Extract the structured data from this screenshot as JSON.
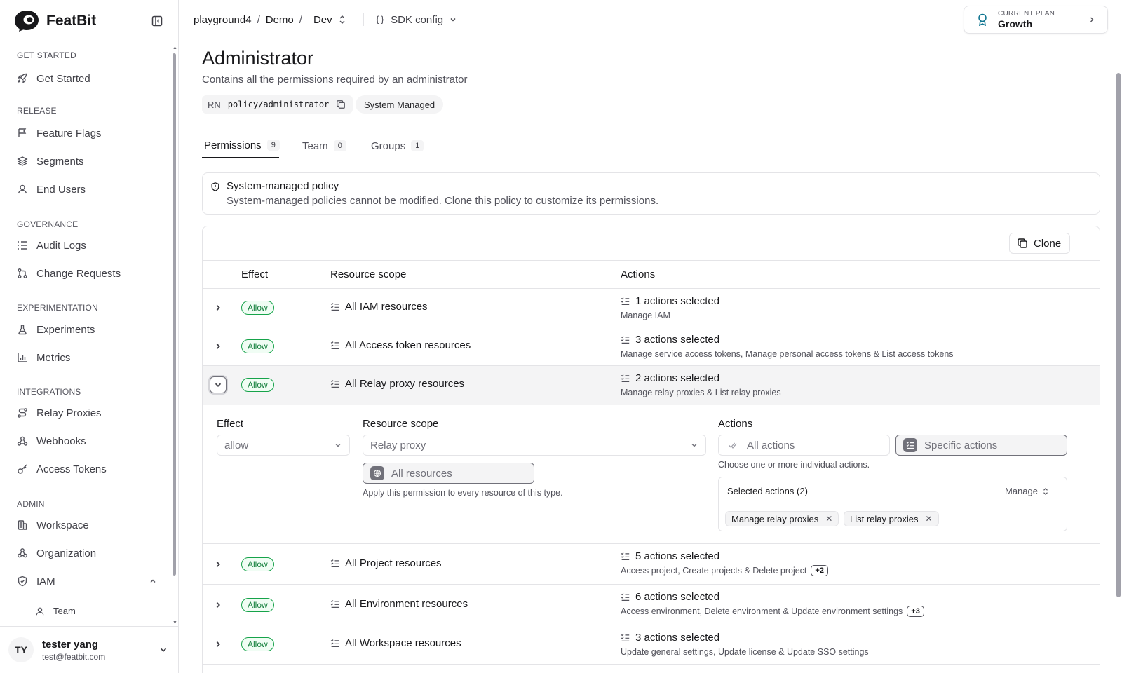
{
  "brand": {
    "name": "FeatBit"
  },
  "sidebar": {
    "sections": [
      {
        "label": "GET STARTED"
      },
      {
        "label": "RELEASE"
      },
      {
        "label": "GOVERNANCE"
      },
      {
        "label": "EXPERIMENTATION"
      },
      {
        "label": "INTEGRATIONS"
      },
      {
        "label": "ADMIN"
      }
    ],
    "items": [
      {
        "label": "Get Started",
        "icon": "rocket-icon"
      },
      {
        "label": "Feature Flags",
        "icon": "flag-icon"
      },
      {
        "label": "Segments",
        "icon": "layers-icon"
      },
      {
        "label": "End Users",
        "icon": "user-icon"
      },
      {
        "label": "Audit Logs",
        "icon": "list-icon"
      },
      {
        "label": "Change Requests",
        "icon": "git-pull-request-icon"
      },
      {
        "label": "Experiments",
        "icon": "flask-icon"
      },
      {
        "label": "Metrics",
        "icon": "bar-chart-icon"
      },
      {
        "label": "Relay Proxies",
        "icon": "route-icon"
      },
      {
        "label": "Webhooks",
        "icon": "webhook-icon"
      },
      {
        "label": "Access Tokens",
        "icon": "key-icon"
      },
      {
        "label": "Workspace",
        "icon": "building-icon"
      },
      {
        "label": "Organization",
        "icon": "network-icon"
      },
      {
        "label": "IAM",
        "icon": "shield-icon"
      }
    ],
    "subitems": [
      {
        "label": "Team",
        "icon": "user-icon"
      }
    ]
  },
  "user": {
    "initials": "TY",
    "name": "tester yang",
    "email": "test@featbit.com"
  },
  "breadcrumb": {
    "project": "playground4",
    "app": "Demo",
    "env": "Dev",
    "sdk": "SDK config"
  },
  "plan": {
    "label": "CURRENT PLAN",
    "value": "Growth"
  },
  "policy": {
    "title": "Administrator",
    "description": "Contains all the permissions required by an administrator",
    "rn_label": "RN",
    "rn_value": "policy/administrator",
    "system_badge": "System Managed"
  },
  "tabs": [
    {
      "label": "Permissions",
      "count": "9"
    },
    {
      "label": "Team",
      "count": "0"
    },
    {
      "label": "Groups",
      "count": "1"
    }
  ],
  "notice": {
    "title": "System-managed policy",
    "body": "System-managed policies cannot be modified. Clone this policy to customize its permissions."
  },
  "table": {
    "clone_label": "Clone",
    "headers": {
      "effect": "Effect",
      "scope": "Resource scope",
      "actions": "Actions"
    },
    "rows": [
      {
        "effect": "Allow",
        "scope": "All IAM resources",
        "actions_title": "1 actions selected",
        "actions_sub": "Manage IAM",
        "more": ""
      },
      {
        "effect": "Allow",
        "scope": "All Access token resources",
        "actions_title": "3 actions selected",
        "actions_sub": "Manage service access tokens, Manage personal access tokens & List access tokens",
        "more": ""
      },
      {
        "effect": "Allow",
        "scope": "All Relay proxy resources",
        "actions_title": "2 actions selected",
        "actions_sub": "Manage relay proxies & List relay proxies",
        "more": ""
      },
      {
        "effect": "Allow",
        "scope": "All Project resources",
        "actions_title": "5 actions selected",
        "actions_sub": "Access project, Create projects & Delete project",
        "more": "+2"
      },
      {
        "effect": "Allow",
        "scope": "All Environment resources",
        "actions_title": "6 actions selected",
        "actions_sub": "Access environment, Delete environment & Update environment settings",
        "more": "+3"
      },
      {
        "effect": "Allow",
        "scope": "All Workspace resources",
        "actions_title": "3 actions selected",
        "actions_sub": "Update general settings, Update license & Update SSO settings",
        "more": ""
      }
    ]
  },
  "detail": {
    "effect_label": "Effect",
    "effect_value": "allow",
    "scope_label": "Resource scope",
    "scope_value": "Relay proxy",
    "all_resources": "All resources",
    "scope_help": "Apply this permission to every resource of this type.",
    "actions_label": "Actions",
    "all_actions": "All actions",
    "specific_actions": "Specific actions",
    "actions_help": "Choose one or more individual actions.",
    "selected_title": "Selected actions (2)",
    "manage_label": "Manage",
    "tags": [
      "Manage relay proxies",
      "List relay proxies"
    ]
  },
  "colors": {
    "allow_green": "#16a34a",
    "accent": "#18181b"
  }
}
